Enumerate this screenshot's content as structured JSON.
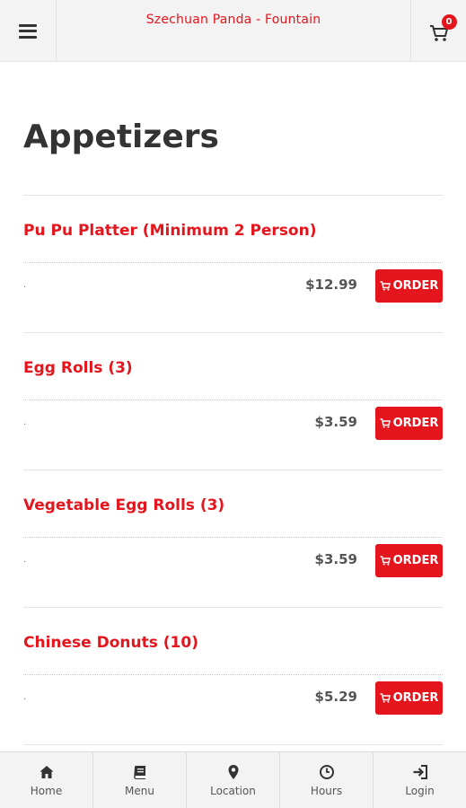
{
  "header": {
    "title": "Szechuan Panda - Fountain",
    "menu_icon": "hamburger-icon",
    "cart_icon": "cart-icon",
    "cart_count": "0"
  },
  "page": {
    "title": "Appetizers"
  },
  "items": [
    {
      "name": "Pu Pu Platter (Minimum 2 Person)",
      "description": ".",
      "price": "$12.99",
      "order_label": "ORDER"
    },
    {
      "name": "Egg Rolls (3)",
      "description": ".",
      "price": "$3.59",
      "order_label": "ORDER"
    },
    {
      "name": "Vegetable Egg Rolls (3)",
      "description": ".",
      "price": "$3.59",
      "order_label": "ORDER"
    },
    {
      "name": "Chinese Donuts (10)",
      "description": ".",
      "price": "$5.29",
      "order_label": "ORDER"
    }
  ],
  "bottom_nav": [
    {
      "label": "Home",
      "icon": "home-icon"
    },
    {
      "label": "Menu",
      "icon": "book-icon"
    },
    {
      "label": "Location",
      "icon": "map-marker-icon"
    },
    {
      "label": "Hours",
      "icon": "clock-icon"
    },
    {
      "label": "Login",
      "icon": "sign-in-icon"
    }
  ],
  "colors": {
    "accent": "#e4151c",
    "header_bg": "#f3f3f3",
    "text_dark": "#333333"
  }
}
